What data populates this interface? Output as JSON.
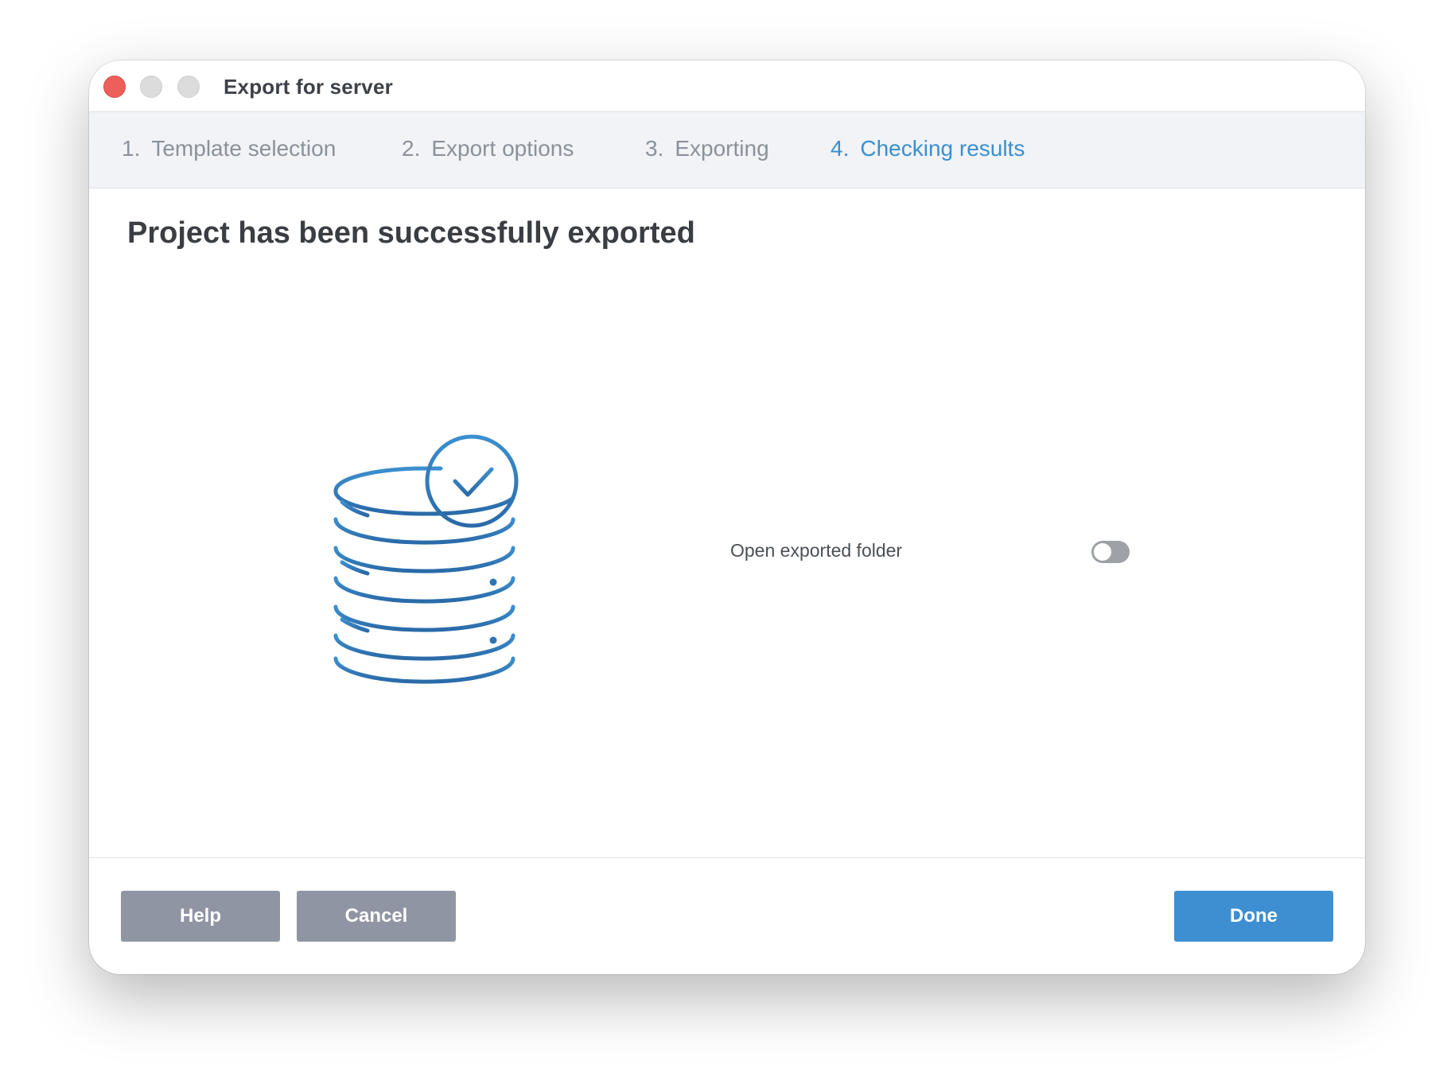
{
  "window": {
    "title": "Export for server"
  },
  "steps": [
    {
      "number": "1.",
      "label": "Template selection",
      "active": false
    },
    {
      "number": "2.",
      "label": "Export options",
      "active": false
    },
    {
      "number": "3.",
      "label": "Exporting",
      "active": false
    },
    {
      "number": "4.",
      "label": "Checking results",
      "active": true
    }
  ],
  "main": {
    "heading": "Project has been successfully exported",
    "illustration_icon": "database-check-icon",
    "open_folder_label": "Open exported folder",
    "open_folder_enabled": false
  },
  "footer": {
    "help_label": "Help",
    "cancel_label": "Cancel",
    "done_label": "Done"
  },
  "colors": {
    "accent": "#3d8fd1",
    "active_step": "#3a8fd0",
    "secondary_button": "#8f95a3",
    "close_button": "#ec5f5a"
  }
}
